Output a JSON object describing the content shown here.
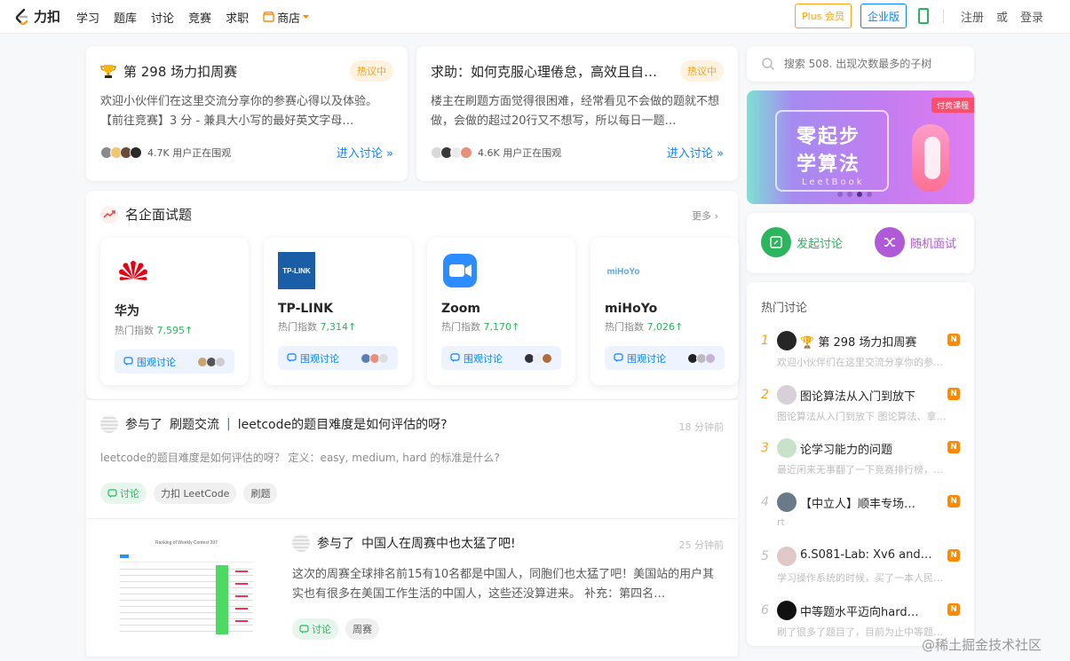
{
  "nav": {
    "logo_text": "力扣",
    "items": [
      "学习",
      "题库",
      "讨论",
      "竞赛",
      "求职"
    ],
    "shop": "商店",
    "plus": "Plus 会员",
    "enterprise": "企业版",
    "register": "注册",
    "or": "或",
    "login": "登录"
  },
  "hot_cards": [
    {
      "title": "第 298 场力扣周赛",
      "badge": "热议中",
      "desc": "欢迎小伙伴们在这里交流分享你的参赛心得以及体验。【前往竞赛】3 分 - 兼具大小写的最好英文字母…",
      "watchers": "4.7K 用户正在围观",
      "enter": "进入讨论 »"
    },
    {
      "title": "求助：如何克服心理倦怠，高效且自…",
      "badge": "热议中",
      "desc": "楼主在刷题方面觉得很困难，经常看见不会做的题就不想做，会做的超过20行又不想写，所以每日一题…",
      "watchers": "4.6K 用户正在围观",
      "enter": "进入讨论 »"
    }
  ],
  "companies": {
    "title": "名企面试题",
    "more": "更多 ›",
    "items": [
      {
        "name": "华为",
        "index_label": "热门指数",
        "index": "7,595↑",
        "watch": "围观讨论",
        "logo_color": "#e60012"
      },
      {
        "name": "TP-LINK",
        "index_label": "热门指数",
        "index": "7,314↑",
        "watch": "围观讨论",
        "logo_color": "#1a5ea8",
        "logo_text": "TP-LINK"
      },
      {
        "name": "Zoom",
        "index_label": "热门指数",
        "index": "7,170↑",
        "watch": "围观讨论",
        "logo_color": "#2d8cff"
      },
      {
        "name": "miHoYo",
        "index_label": "热门指数",
        "index": "7,026↑",
        "watch": "围观讨论",
        "logo_color": "#5aa7e0",
        "logo_text": "miHoYo"
      }
    ]
  },
  "feed": [
    {
      "action": "参与了",
      "topic": "刷题交流",
      "pipe": "|",
      "title": "leetcode的题目难度是如何评估的呀?",
      "time": "18 分钟前",
      "desc": "leetcode的题目难度是如何评估的呀？ 定义：easy, medium, hard 的标准是什么?",
      "tags": [
        "讨论",
        "力扣 LeetCode",
        "刷题"
      ]
    },
    {
      "action": "参与了",
      "title": "中国人在周赛中也太猛了吧!",
      "time": "25 分钟前",
      "desc": "这次的周赛全球排名前15有10名都是中国人，同胞们也太猛了吧！美国站的用户其实也有很多在美国工作生活的中国人，这些还没算进来。 补充：第四名…",
      "tags": [
        "讨论",
        "周赛"
      ],
      "thumb_title": "Ranking of Weekly Contest 297"
    }
  ],
  "search": {
    "placeholder": "搜索 508. 出现次数最多的子树"
  },
  "banner": {
    "line1": "零起步",
    "line2": "学算法",
    "line3": "LeetBook",
    "pay": "付费课程"
  },
  "actions": {
    "start": "发起讨论",
    "random": "随机面试"
  },
  "hot_list": {
    "title": "热门讨论",
    "items": [
      {
        "rank": "1",
        "title": "第 298 场力扣周赛",
        "sub": "欢迎小伙伴们在这里交流分享你的参…",
        "badge": "N"
      },
      {
        "rank": "2",
        "title": "图论算法从入门到放下",
        "sub": "图论算法从入门到放下 图论算法、拿…",
        "badge": "N"
      },
      {
        "rank": "3",
        "title": "论学习能力的问题",
        "sub": "最近闲来无事翻了一下竞赛排行榜，…",
        "badge": "N"
      },
      {
        "rank": "4",
        "title": "【中立人】顺丰专场…",
        "sub": "rt",
        "badge": "N"
      },
      {
        "rank": "5",
        "title": "6.S081-Lab: Xv6 and…",
        "sub": "学习操作系统的时候，买了一本人民…",
        "badge": "N"
      },
      {
        "rank": "6",
        "title": "中等题水平迈向hard…",
        "sub": "刷了很多了题目了，目前为止中等题…",
        "badge": "N"
      }
    ]
  },
  "watermark": "@稀土掘金技术社区",
  "colors": {
    "accent": "#ffa116",
    "link": "#0a84ff",
    "green": "#2db55d",
    "orange": "#ff8a00"
  }
}
